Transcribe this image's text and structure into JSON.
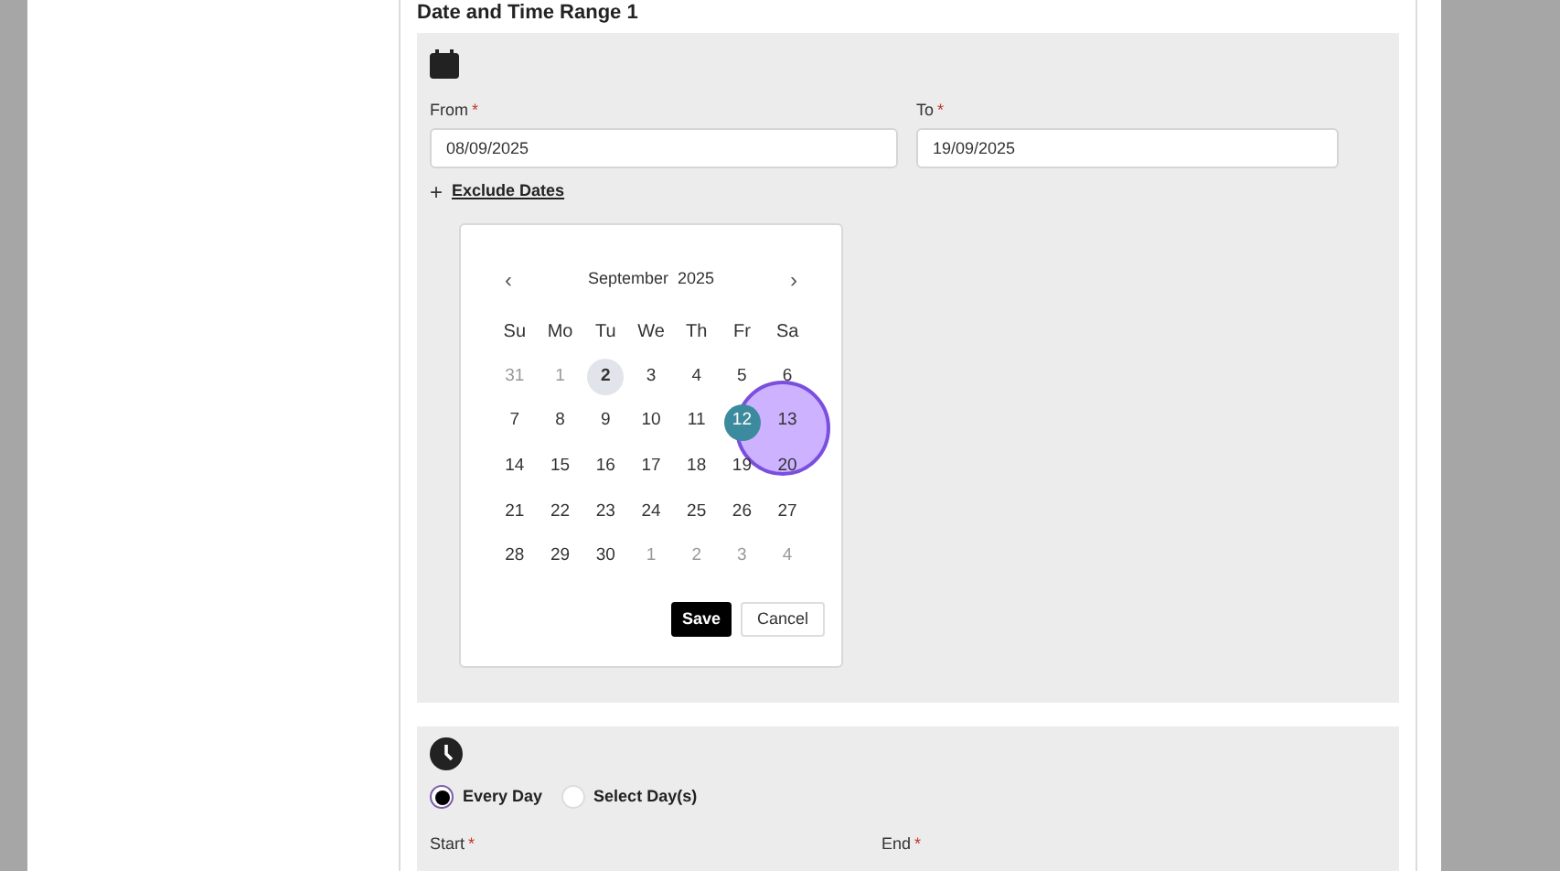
{
  "section_title": "Date and Time Range 1",
  "from": {
    "label": "From",
    "required_mark": "*",
    "value": "08/09/2025"
  },
  "to": {
    "label": "To",
    "required_mark": "*",
    "value": "19/09/2025"
  },
  "exclude_dates": {
    "icon": "+",
    "label": "Exclude Dates"
  },
  "calendar": {
    "prev": "‹",
    "next": "›",
    "month": "September",
    "year": "2025",
    "weekdays": [
      "Su",
      "Mo",
      "Tu",
      "We",
      "Th",
      "Fr",
      "Sa"
    ],
    "days": [
      {
        "label": "31",
        "muted": true,
        "today": false,
        "selected": false
      },
      {
        "label": "1",
        "muted": true,
        "today": false,
        "selected": false
      },
      {
        "label": "2",
        "muted": false,
        "today": true,
        "selected": false
      },
      {
        "label": "3",
        "muted": false,
        "today": false,
        "selected": false
      },
      {
        "label": "4",
        "muted": false,
        "today": false,
        "selected": false
      },
      {
        "label": "5",
        "muted": false,
        "today": false,
        "selected": false
      },
      {
        "label": "6",
        "muted": false,
        "today": false,
        "selected": false
      },
      {
        "label": "7",
        "muted": false,
        "today": false,
        "selected": false
      },
      {
        "label": "8",
        "muted": false,
        "today": false,
        "selected": false
      },
      {
        "label": "9",
        "muted": false,
        "today": false,
        "selected": false
      },
      {
        "label": "10",
        "muted": false,
        "today": false,
        "selected": false
      },
      {
        "label": "11",
        "muted": false,
        "today": false,
        "selected": false
      },
      {
        "label": "12",
        "muted": false,
        "today": false,
        "selected": true
      },
      {
        "label": "13",
        "muted": false,
        "today": false,
        "selected": false
      },
      {
        "label": "14",
        "muted": false,
        "today": false,
        "selected": false
      },
      {
        "label": "15",
        "muted": false,
        "today": false,
        "selected": false
      },
      {
        "label": "16",
        "muted": false,
        "today": false,
        "selected": false
      },
      {
        "label": "17",
        "muted": false,
        "today": false,
        "selected": false
      },
      {
        "label": "18",
        "muted": false,
        "today": false,
        "selected": false
      },
      {
        "label": "19",
        "muted": false,
        "today": false,
        "selected": false
      },
      {
        "label": "20",
        "muted": false,
        "today": false,
        "selected": false
      },
      {
        "label": "21",
        "muted": false,
        "today": false,
        "selected": false
      },
      {
        "label": "22",
        "muted": false,
        "today": false,
        "selected": false
      },
      {
        "label": "23",
        "muted": false,
        "today": false,
        "selected": false
      },
      {
        "label": "24",
        "muted": false,
        "today": false,
        "selected": false
      },
      {
        "label": "25",
        "muted": false,
        "today": false,
        "selected": false
      },
      {
        "label": "26",
        "muted": false,
        "today": false,
        "selected": false
      },
      {
        "label": "27",
        "muted": false,
        "today": false,
        "selected": false
      },
      {
        "label": "28",
        "muted": false,
        "today": false,
        "selected": false
      },
      {
        "label": "29",
        "muted": false,
        "today": false,
        "selected": false
      },
      {
        "label": "30",
        "muted": false,
        "today": false,
        "selected": false
      },
      {
        "label": "1",
        "muted": true,
        "today": false,
        "selected": false
      },
      {
        "label": "2",
        "muted": true,
        "today": false,
        "selected": false
      },
      {
        "label": "3",
        "muted": true,
        "today": false,
        "selected": false
      },
      {
        "label": "4",
        "muted": true,
        "today": false,
        "selected": false
      }
    ],
    "buttons": [
      {
        "label": "Save",
        "kind": "primary"
      },
      {
        "label": "Cancel",
        "kind": "secondary"
      }
    ]
  },
  "recurrence": [
    {
      "label": "Every Day",
      "selected": true
    },
    {
      "label": "Select Day(s)",
      "selected": false
    }
  ],
  "start": {
    "label": "Start",
    "required_mark": "*"
  },
  "end": {
    "label": "End",
    "required_mark": "*"
  }
}
